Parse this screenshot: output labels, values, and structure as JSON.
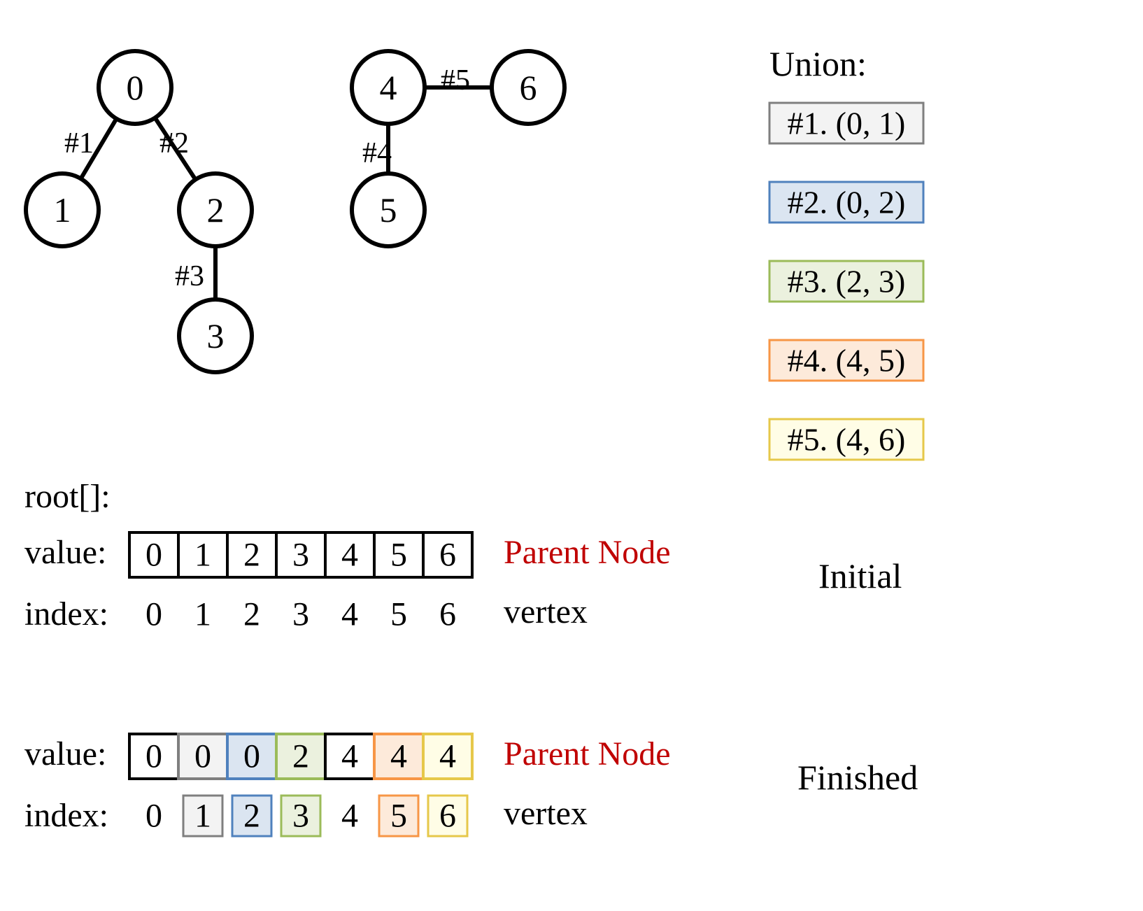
{
  "graph": {
    "nodes": {
      "n0": "0",
      "n1": "1",
      "n2": "2",
      "n3": "3",
      "n4": "4",
      "n5": "5",
      "n6": "6"
    },
    "edges": {
      "e1": "#1",
      "e2": "#2",
      "e3": "#3",
      "e4": "#4",
      "e5": "#5"
    }
  },
  "union": {
    "title": "Union:",
    "items": {
      "u1": "#1. (0, 1)",
      "u2": "#2. (0, 2)",
      "u3": "#3. (2, 3)",
      "u4": "#4. (4, 5)",
      "u5": "#5. (4, 6)"
    }
  },
  "array": {
    "root_label": "root[]:",
    "value_label": "value:",
    "index_label": "index:",
    "parent_label": "Parent Node",
    "vertex_label": "vertex",
    "initial_label": "Initial",
    "finished_label": "Finished",
    "initial": {
      "values": [
        "0",
        "1",
        "2",
        "3",
        "4",
        "5",
        "6"
      ],
      "indices": [
        "0",
        "1",
        "2",
        "3",
        "4",
        "5",
        "6"
      ]
    },
    "finished": {
      "values": [
        "0",
        "0",
        "0",
        "2",
        "4",
        "4",
        "4"
      ],
      "indices": [
        "0",
        "1",
        "2",
        "3",
        "4",
        "5",
        "6"
      ]
    }
  },
  "colors": {
    "gray": {
      "fill": "#f3f3f3",
      "stroke": "#7f7f7f"
    },
    "blue": {
      "fill": "#dbe5f1",
      "stroke": "#4f81bd"
    },
    "green": {
      "fill": "#ebf1de",
      "stroke": "#9bbb59"
    },
    "orange": {
      "fill": "#fdeada",
      "stroke": "#f79646"
    },
    "yellow": {
      "fill": "#fffde6",
      "stroke": "#e6c84a"
    }
  }
}
